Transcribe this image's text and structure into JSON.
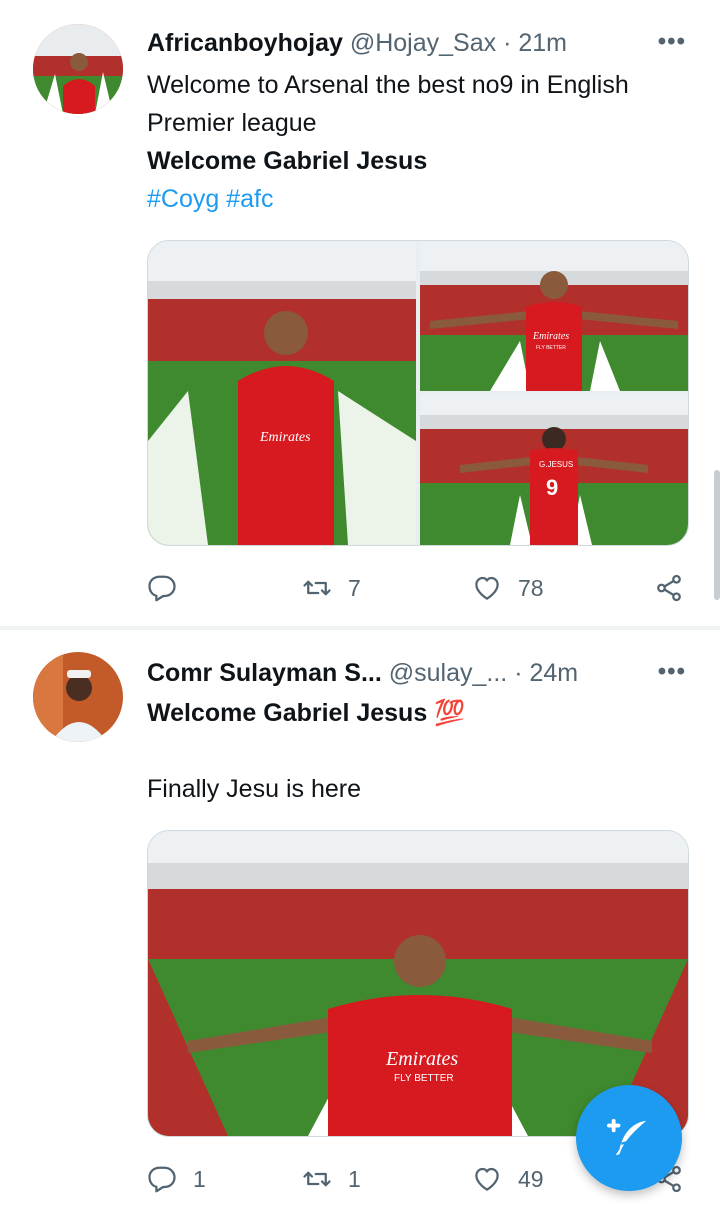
{
  "tweets": [
    {
      "name": "Africanboyhojay",
      "handle": "@Hojay_Sax",
      "separator": "·",
      "time": "21m",
      "more_label": "•••",
      "line1": "Welcome to Arsenal the best no9 in English",
      "line2": "Premier league",
      "line3": "Welcome Gabriel Jesus",
      "hashtags": [
        "#Coyg",
        "#afc"
      ],
      "retweets": "7",
      "likes": "78"
    },
    {
      "name": "Comr Sulayman S...",
      "handle": "@sulay_...",
      "separator": "·",
      "time": "24m",
      "more_label": "•••",
      "line1": "Welcome Gabriel Jesus",
      "emoji": "💯",
      "line2": "Finally Jesu is here",
      "replies": "1",
      "retweets": "1",
      "likes": "49"
    }
  ],
  "jersey": {
    "sponsor": "Emirates",
    "slogan": "FLY BETTER",
    "back_name": "G.JESUS",
    "back_number": "9"
  },
  "colors": {
    "accent": "#1d9bf0",
    "arsenal_red": "#d71920",
    "pitch": "#3f8a2e",
    "stands": "#b2302c"
  },
  "icons": [
    "reply-icon",
    "retweet-icon",
    "like-icon",
    "share-icon",
    "more-icon",
    "compose-tweet-icon"
  ]
}
